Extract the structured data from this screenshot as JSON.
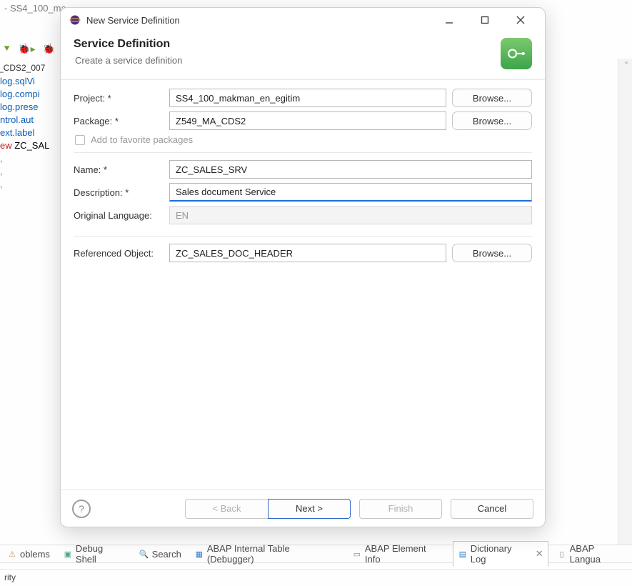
{
  "bg": {
    "title_prefix": "- SS4_100_ma",
    "tab_label": "_CDS2_007",
    "editor_lines": [
      {
        "text": "log.sqlVi",
        "class": "c-blue"
      },
      {
        "text": "log.compi",
        "class": "c-blue"
      },
      {
        "text": "log.prese",
        "class": "c-blue"
      },
      {
        "text": "ntrol.aut",
        "class": "c-blue"
      },
      {
        "text": "ext.label",
        "class": "c-blue"
      },
      {
        "text": "ew ZC_SAL",
        "class": "c-black",
        "prefix": "ew ",
        "prefix_class": "c-red"
      }
    ],
    "tabs": [
      {
        "label": "oblems",
        "icon": "warning",
        "color": "#c96"
      },
      {
        "label": "Debug Shell",
        "icon": "debug",
        "color": "#4a8"
      },
      {
        "label": "Search",
        "icon": "search",
        "color": "#c96"
      },
      {
        "label": "ABAP Internal Table (Debugger)",
        "icon": "table",
        "color": "#3a80c8"
      },
      {
        "label": "ABAP Element Info",
        "icon": "info",
        "color": "#888"
      },
      {
        "label": "Dictionary Log",
        "icon": "log",
        "color": "#3a80c8",
        "selected": true,
        "closable": true
      },
      {
        "label": "ABAP Langua",
        "icon": "doc",
        "color": "#888"
      }
    ],
    "footer": "rity"
  },
  "dialog": {
    "title": "New Service Definition",
    "banner": {
      "heading": "Service Definition",
      "subtext": "Create a service definition"
    },
    "labels": {
      "project": "Project: *",
      "package": "Package: *",
      "add_fav": "Add to favorite packages",
      "name": "Name: *",
      "description": "Description: *",
      "orig_lang": "Original Language:",
      "ref_object": "Referenced Object:"
    },
    "values": {
      "project": "SS4_100_makman_en_egitim",
      "package": "Z549_MA_CDS2",
      "name": "ZC_SALES_SRV",
      "description": "Sales document Service",
      "orig_lang": "EN",
      "ref_object": "ZC_SALES_DOC_HEADER"
    },
    "buttons": {
      "browse": "Browse...",
      "back": "< Back",
      "next": "Next >",
      "finish": "Finish",
      "cancel": "Cancel"
    }
  }
}
